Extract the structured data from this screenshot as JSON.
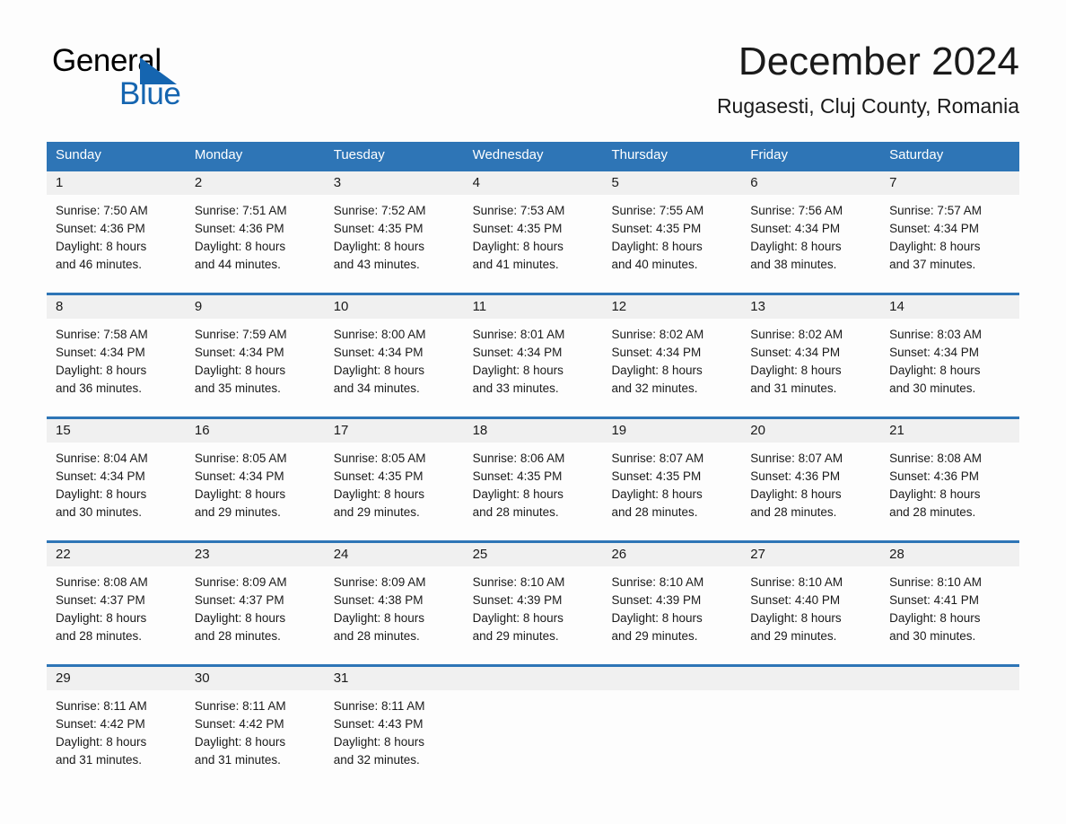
{
  "brand": {
    "name_part1": "General",
    "name_part2": "Blue",
    "triangle_icon": "brand-triangle-icon",
    "colors": {
      "black": "#000000",
      "blue": "#1565b0"
    }
  },
  "header": {
    "title": "December 2024",
    "subtitle": "Rugasesti, Cluj County, Romania"
  },
  "theme": {
    "header_blue": "#2e75b6",
    "date_band_gray": "#f0f0f0",
    "page_background": "#fdfdfd",
    "text": "#1a1a1a"
  },
  "weekdays": [
    "Sunday",
    "Monday",
    "Tuesday",
    "Wednesday",
    "Thursday",
    "Friday",
    "Saturday"
  ],
  "weeks": [
    {
      "days": [
        {
          "date": "1",
          "sunrise": "Sunrise: 7:50 AM",
          "sunset": "Sunset: 4:36 PM",
          "daylight_line1": "Daylight: 8 hours",
          "daylight_line2": "and 46 minutes."
        },
        {
          "date": "2",
          "sunrise": "Sunrise: 7:51 AM",
          "sunset": "Sunset: 4:36 PM",
          "daylight_line1": "Daylight: 8 hours",
          "daylight_line2": "and 44 minutes."
        },
        {
          "date": "3",
          "sunrise": "Sunrise: 7:52 AM",
          "sunset": "Sunset: 4:35 PM",
          "daylight_line1": "Daylight: 8 hours",
          "daylight_line2": "and 43 minutes."
        },
        {
          "date": "4",
          "sunrise": "Sunrise: 7:53 AM",
          "sunset": "Sunset: 4:35 PM",
          "daylight_line1": "Daylight: 8 hours",
          "daylight_line2": "and 41 minutes."
        },
        {
          "date": "5",
          "sunrise": "Sunrise: 7:55 AM",
          "sunset": "Sunset: 4:35 PM",
          "daylight_line1": "Daylight: 8 hours",
          "daylight_line2": "and 40 minutes."
        },
        {
          "date": "6",
          "sunrise": "Sunrise: 7:56 AM",
          "sunset": "Sunset: 4:34 PM",
          "daylight_line1": "Daylight: 8 hours",
          "daylight_line2": "and 38 minutes."
        },
        {
          "date": "7",
          "sunrise": "Sunrise: 7:57 AM",
          "sunset": "Sunset: 4:34 PM",
          "daylight_line1": "Daylight: 8 hours",
          "daylight_line2": "and 37 minutes."
        }
      ]
    },
    {
      "days": [
        {
          "date": "8",
          "sunrise": "Sunrise: 7:58 AM",
          "sunset": "Sunset: 4:34 PM",
          "daylight_line1": "Daylight: 8 hours",
          "daylight_line2": "and 36 minutes."
        },
        {
          "date": "9",
          "sunrise": "Sunrise: 7:59 AM",
          "sunset": "Sunset: 4:34 PM",
          "daylight_line1": "Daylight: 8 hours",
          "daylight_line2": "and 35 minutes."
        },
        {
          "date": "10",
          "sunrise": "Sunrise: 8:00 AM",
          "sunset": "Sunset: 4:34 PM",
          "daylight_line1": "Daylight: 8 hours",
          "daylight_line2": "and 34 minutes."
        },
        {
          "date": "11",
          "sunrise": "Sunrise: 8:01 AM",
          "sunset": "Sunset: 4:34 PM",
          "daylight_line1": "Daylight: 8 hours",
          "daylight_line2": "and 33 minutes."
        },
        {
          "date": "12",
          "sunrise": "Sunrise: 8:02 AM",
          "sunset": "Sunset: 4:34 PM",
          "daylight_line1": "Daylight: 8 hours",
          "daylight_line2": "and 32 minutes."
        },
        {
          "date": "13",
          "sunrise": "Sunrise: 8:02 AM",
          "sunset": "Sunset: 4:34 PM",
          "daylight_line1": "Daylight: 8 hours",
          "daylight_line2": "and 31 minutes."
        },
        {
          "date": "14",
          "sunrise": "Sunrise: 8:03 AM",
          "sunset": "Sunset: 4:34 PM",
          "daylight_line1": "Daylight: 8 hours",
          "daylight_line2": "and 30 minutes."
        }
      ]
    },
    {
      "days": [
        {
          "date": "15",
          "sunrise": "Sunrise: 8:04 AM",
          "sunset": "Sunset: 4:34 PM",
          "daylight_line1": "Daylight: 8 hours",
          "daylight_line2": "and 30 minutes."
        },
        {
          "date": "16",
          "sunrise": "Sunrise: 8:05 AM",
          "sunset": "Sunset: 4:34 PM",
          "daylight_line1": "Daylight: 8 hours",
          "daylight_line2": "and 29 minutes."
        },
        {
          "date": "17",
          "sunrise": "Sunrise: 8:05 AM",
          "sunset": "Sunset: 4:35 PM",
          "daylight_line1": "Daylight: 8 hours",
          "daylight_line2": "and 29 minutes."
        },
        {
          "date": "18",
          "sunrise": "Sunrise: 8:06 AM",
          "sunset": "Sunset: 4:35 PM",
          "daylight_line1": "Daylight: 8 hours",
          "daylight_line2": "and 28 minutes."
        },
        {
          "date": "19",
          "sunrise": "Sunrise: 8:07 AM",
          "sunset": "Sunset: 4:35 PM",
          "daylight_line1": "Daylight: 8 hours",
          "daylight_line2": "and 28 minutes."
        },
        {
          "date": "20",
          "sunrise": "Sunrise: 8:07 AM",
          "sunset": "Sunset: 4:36 PM",
          "daylight_line1": "Daylight: 8 hours",
          "daylight_line2": "and 28 minutes."
        },
        {
          "date": "21",
          "sunrise": "Sunrise: 8:08 AM",
          "sunset": "Sunset: 4:36 PM",
          "daylight_line1": "Daylight: 8 hours",
          "daylight_line2": "and 28 minutes."
        }
      ]
    },
    {
      "days": [
        {
          "date": "22",
          "sunrise": "Sunrise: 8:08 AM",
          "sunset": "Sunset: 4:37 PM",
          "daylight_line1": "Daylight: 8 hours",
          "daylight_line2": "and 28 minutes."
        },
        {
          "date": "23",
          "sunrise": "Sunrise: 8:09 AM",
          "sunset": "Sunset: 4:37 PM",
          "daylight_line1": "Daylight: 8 hours",
          "daylight_line2": "and 28 minutes."
        },
        {
          "date": "24",
          "sunrise": "Sunrise: 8:09 AM",
          "sunset": "Sunset: 4:38 PM",
          "daylight_line1": "Daylight: 8 hours",
          "daylight_line2": "and 28 minutes."
        },
        {
          "date": "25",
          "sunrise": "Sunrise: 8:10 AM",
          "sunset": "Sunset: 4:39 PM",
          "daylight_line1": "Daylight: 8 hours",
          "daylight_line2": "and 29 minutes."
        },
        {
          "date": "26",
          "sunrise": "Sunrise: 8:10 AM",
          "sunset": "Sunset: 4:39 PM",
          "daylight_line1": "Daylight: 8 hours",
          "daylight_line2": "and 29 minutes."
        },
        {
          "date": "27",
          "sunrise": "Sunrise: 8:10 AM",
          "sunset": "Sunset: 4:40 PM",
          "daylight_line1": "Daylight: 8 hours",
          "daylight_line2": "and 29 minutes."
        },
        {
          "date": "28",
          "sunrise": "Sunrise: 8:10 AM",
          "sunset": "Sunset: 4:41 PM",
          "daylight_line1": "Daylight: 8 hours",
          "daylight_line2": "and 30 minutes."
        }
      ]
    },
    {
      "days": [
        {
          "date": "29",
          "sunrise": "Sunrise: 8:11 AM",
          "sunset": "Sunset: 4:42 PM",
          "daylight_line1": "Daylight: 8 hours",
          "daylight_line2": "and 31 minutes."
        },
        {
          "date": "30",
          "sunrise": "Sunrise: 8:11 AM",
          "sunset": "Sunset: 4:42 PM",
          "daylight_line1": "Daylight: 8 hours",
          "daylight_line2": "and 31 minutes."
        },
        {
          "date": "31",
          "sunrise": "Sunrise: 8:11 AM",
          "sunset": "Sunset: 4:43 PM",
          "daylight_line1": "Daylight: 8 hours",
          "daylight_line2": "and 32 minutes."
        },
        {
          "date": "",
          "sunrise": "",
          "sunset": "",
          "daylight_line1": "",
          "daylight_line2": ""
        },
        {
          "date": "",
          "sunrise": "",
          "sunset": "",
          "daylight_line1": "",
          "daylight_line2": ""
        },
        {
          "date": "",
          "sunrise": "",
          "sunset": "",
          "daylight_line1": "",
          "daylight_line2": ""
        },
        {
          "date": "",
          "sunrise": "",
          "sunset": "",
          "daylight_line1": "",
          "daylight_line2": ""
        }
      ]
    }
  ]
}
